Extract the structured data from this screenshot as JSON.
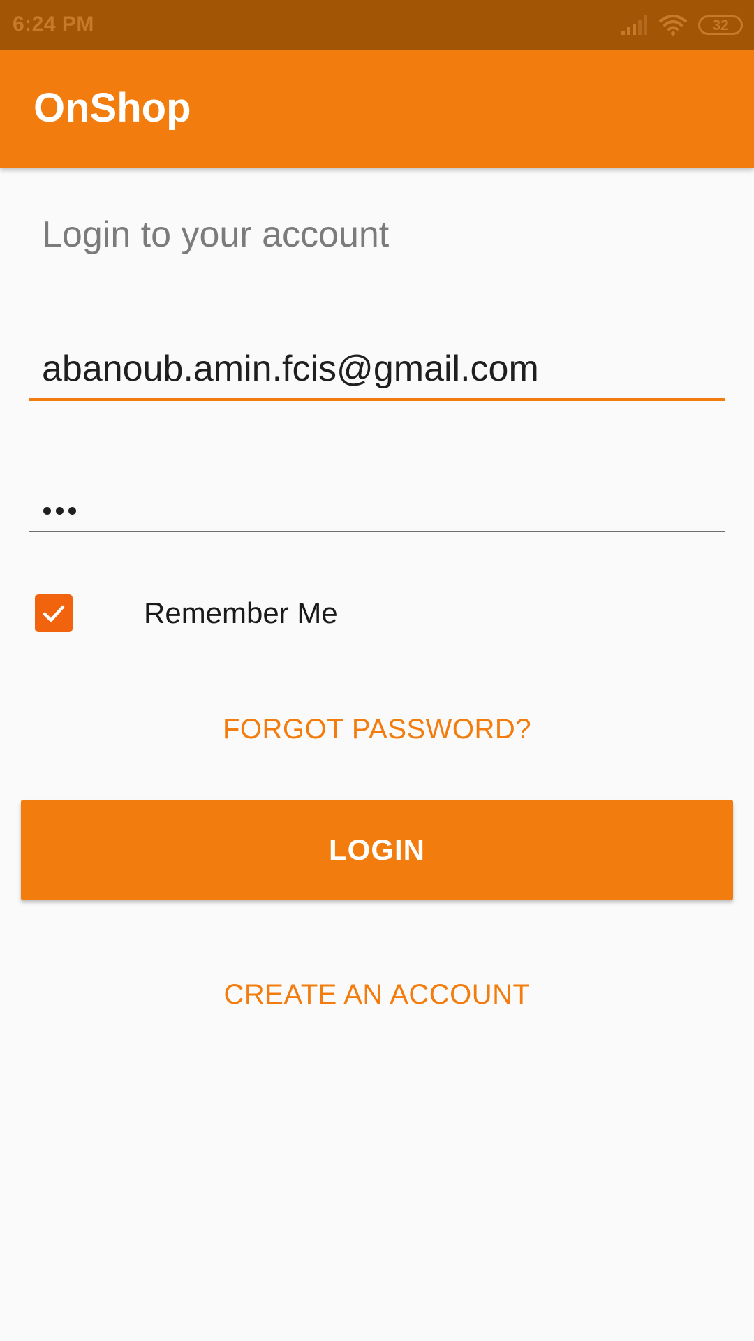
{
  "status_bar": {
    "time": "6:24 PM",
    "battery_level": "32",
    "icons": [
      "signal-icon",
      "wifi-icon",
      "battery-icon"
    ]
  },
  "app_bar": {
    "title": "OnShop"
  },
  "login_form": {
    "heading": "Login to your account",
    "email_value": "abanoub.amin.fcis@gmail.com",
    "password_length": 3,
    "remember_label": "Remember Me",
    "remember_checked": true,
    "forgot_label": "FORGOT PASSWORD?",
    "login_label": "LOGIN",
    "create_label": "CREATE AN ACCOUNT"
  },
  "colors": {
    "status_bar": "#a25605",
    "accent": "#f27d0e",
    "checkbox": "#f2630e",
    "background": "#fafafa"
  }
}
